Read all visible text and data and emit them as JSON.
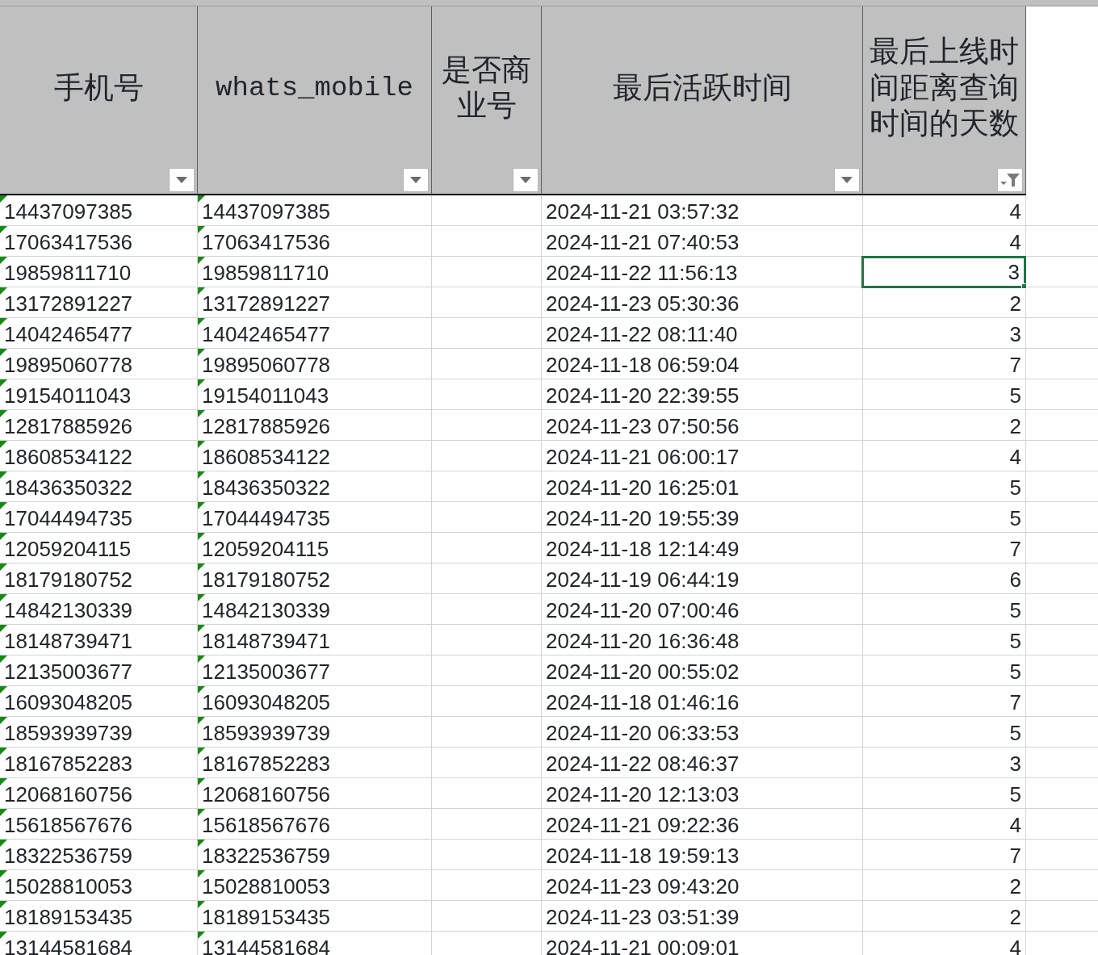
{
  "columns": [
    {
      "label": "手机号",
      "filter_applied": false
    },
    {
      "label": "whats_mobile",
      "filter_applied": false
    },
    {
      "label": "是否商业号",
      "filter_applied": false
    },
    {
      "label": "最后活跃时间",
      "filter_applied": false
    },
    {
      "label": "最后上线时间距离查询时间的天数",
      "filter_applied": true
    }
  ],
  "rows": [
    {
      "phone": "14437097385",
      "whats_mobile": "14437097385",
      "last_active": "2024-11-21 03:57:32",
      "days": "4",
      "text_flag": true,
      "selected": false
    },
    {
      "phone": "17063417536",
      "whats_mobile": "17063417536",
      "last_active": "2024-11-21 07:40:53",
      "days": "4",
      "text_flag": true,
      "selected": false
    },
    {
      "phone": "19859811710",
      "whats_mobile": "19859811710",
      "last_active": "2024-11-22 11:56:13",
      "days": "3",
      "text_flag": true,
      "selected": true
    },
    {
      "phone": "13172891227",
      "whats_mobile": "13172891227",
      "last_active": "2024-11-23 05:30:36",
      "days": "2",
      "text_flag": true,
      "selected": false
    },
    {
      "phone": "14042465477",
      "whats_mobile": "14042465477",
      "last_active": "2024-11-22 08:11:40",
      "days": "3",
      "text_flag": true,
      "selected": false
    },
    {
      "phone": "19895060778",
      "whats_mobile": "19895060778",
      "last_active": "2024-11-18 06:59:04",
      "days": "7",
      "text_flag": true,
      "selected": false
    },
    {
      "phone": "19154011043",
      "whats_mobile": "19154011043",
      "last_active": "2024-11-20 22:39:55",
      "days": "5",
      "text_flag": true,
      "selected": false
    },
    {
      "phone": "12817885926",
      "whats_mobile": "12817885926",
      "last_active": "2024-11-23 07:50:56",
      "days": "2",
      "text_flag": true,
      "selected": false
    },
    {
      "phone": "18608534122",
      "whats_mobile": "18608534122",
      "last_active": "2024-11-21 06:00:17",
      "days": "4",
      "text_flag": true,
      "selected": false
    },
    {
      "phone": "18436350322",
      "whats_mobile": "18436350322",
      "last_active": "2024-11-20 16:25:01",
      "days": "5",
      "text_flag": true,
      "selected": false
    },
    {
      "phone": "17044494735",
      "whats_mobile": "17044494735",
      "last_active": "2024-11-20 19:55:39",
      "days": "5",
      "text_flag": true,
      "selected": false
    },
    {
      "phone": "12059204115",
      "whats_mobile": "12059204115",
      "last_active": "2024-11-18 12:14:49",
      "days": "7",
      "text_flag": true,
      "selected": false
    },
    {
      "phone": "18179180752",
      "whats_mobile": "18179180752",
      "last_active": "2024-11-19 06:44:19",
      "days": "6",
      "text_flag": true,
      "selected": false
    },
    {
      "phone": "14842130339",
      "whats_mobile": "14842130339",
      "last_active": "2024-11-20 07:00:46",
      "days": "5",
      "text_flag": true,
      "selected": false
    },
    {
      "phone": "18148739471",
      "whats_mobile": "18148739471",
      "last_active": "2024-11-20 16:36:48",
      "days": "5",
      "text_flag": true,
      "selected": false
    },
    {
      "phone": "12135003677",
      "whats_mobile": "12135003677",
      "last_active": "2024-11-20 00:55:02",
      "days": "5",
      "text_flag": true,
      "selected": false
    },
    {
      "phone": "16093048205",
      "whats_mobile": "16093048205",
      "last_active": "2024-11-18 01:46:16",
      "days": "7",
      "text_flag": true,
      "selected": false
    },
    {
      "phone": "18593939739",
      "whats_mobile": "18593939739",
      "last_active": "2024-11-20 06:33:53",
      "days": "5",
      "text_flag": true,
      "selected": false
    },
    {
      "phone": "18167852283",
      "whats_mobile": "18167852283",
      "last_active": "2024-11-22 08:46:37",
      "days": "3",
      "text_flag": true,
      "selected": false
    },
    {
      "phone": "12068160756",
      "whats_mobile": "12068160756",
      "last_active": "2024-11-20 12:13:03",
      "days": "5",
      "text_flag": true,
      "selected": false
    },
    {
      "phone": "15618567676",
      "whats_mobile": "15618567676",
      "last_active": "2024-11-21 09:22:36",
      "days": "4",
      "text_flag": true,
      "selected": false
    },
    {
      "phone": "18322536759",
      "whats_mobile": "18322536759",
      "last_active": "2024-11-18 19:59:13",
      "days": "7",
      "text_flag": true,
      "selected": false
    },
    {
      "phone": "15028810053",
      "whats_mobile": "15028810053",
      "last_active": "2024-11-23 09:43:20",
      "days": "2",
      "text_flag": true,
      "selected": false
    },
    {
      "phone": "18189153435",
      "whats_mobile": "18189153435",
      "last_active": "2024-11-23 03:51:39",
      "days": "2",
      "text_flag": true,
      "selected": false
    },
    {
      "phone": "13144581684",
      "whats_mobile": "13144581684",
      "last_active": "2024-11-21 00:09:01",
      "days": "4",
      "text_flag": true,
      "selected": false
    }
  ]
}
